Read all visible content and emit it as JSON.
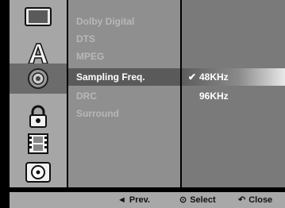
{
  "menu": {
    "items": [
      {
        "label": "Dolby Digital",
        "selected": false
      },
      {
        "label": "DTS",
        "selected": false
      },
      {
        "label": "MPEG",
        "selected": false
      },
      {
        "label": "Sampling Freq.",
        "selected": true
      },
      {
        "label": "DRC",
        "selected": false
      },
      {
        "label": "Surround",
        "selected": false
      }
    ]
  },
  "options": {
    "items": [
      {
        "label": "48KHz",
        "selected": true
      },
      {
        "label": "96KHz",
        "selected": false
      }
    ],
    "check_symbol": "✔"
  },
  "sidebar": {
    "icons": [
      "tv-screen-icon",
      "language-letter-icon",
      "audio-speaker-icon",
      "padlock-icon",
      "film-strip-icon",
      "disc-icon"
    ],
    "selected_index": 2
  },
  "bottom_bar": {
    "prev_symbol": "◄",
    "prev_label": "Prev.",
    "select_symbol": "⊙",
    "select_label": "Select",
    "close_symbol": "↶",
    "close_label": "Close"
  },
  "colors": {
    "selected_text": "#ffffff",
    "dim_text": "#b8b8b8",
    "panel_left": "#a6a6a6",
    "panel_mid": "#8f8f8f",
    "panel_right": "#7a7a7a"
  }
}
